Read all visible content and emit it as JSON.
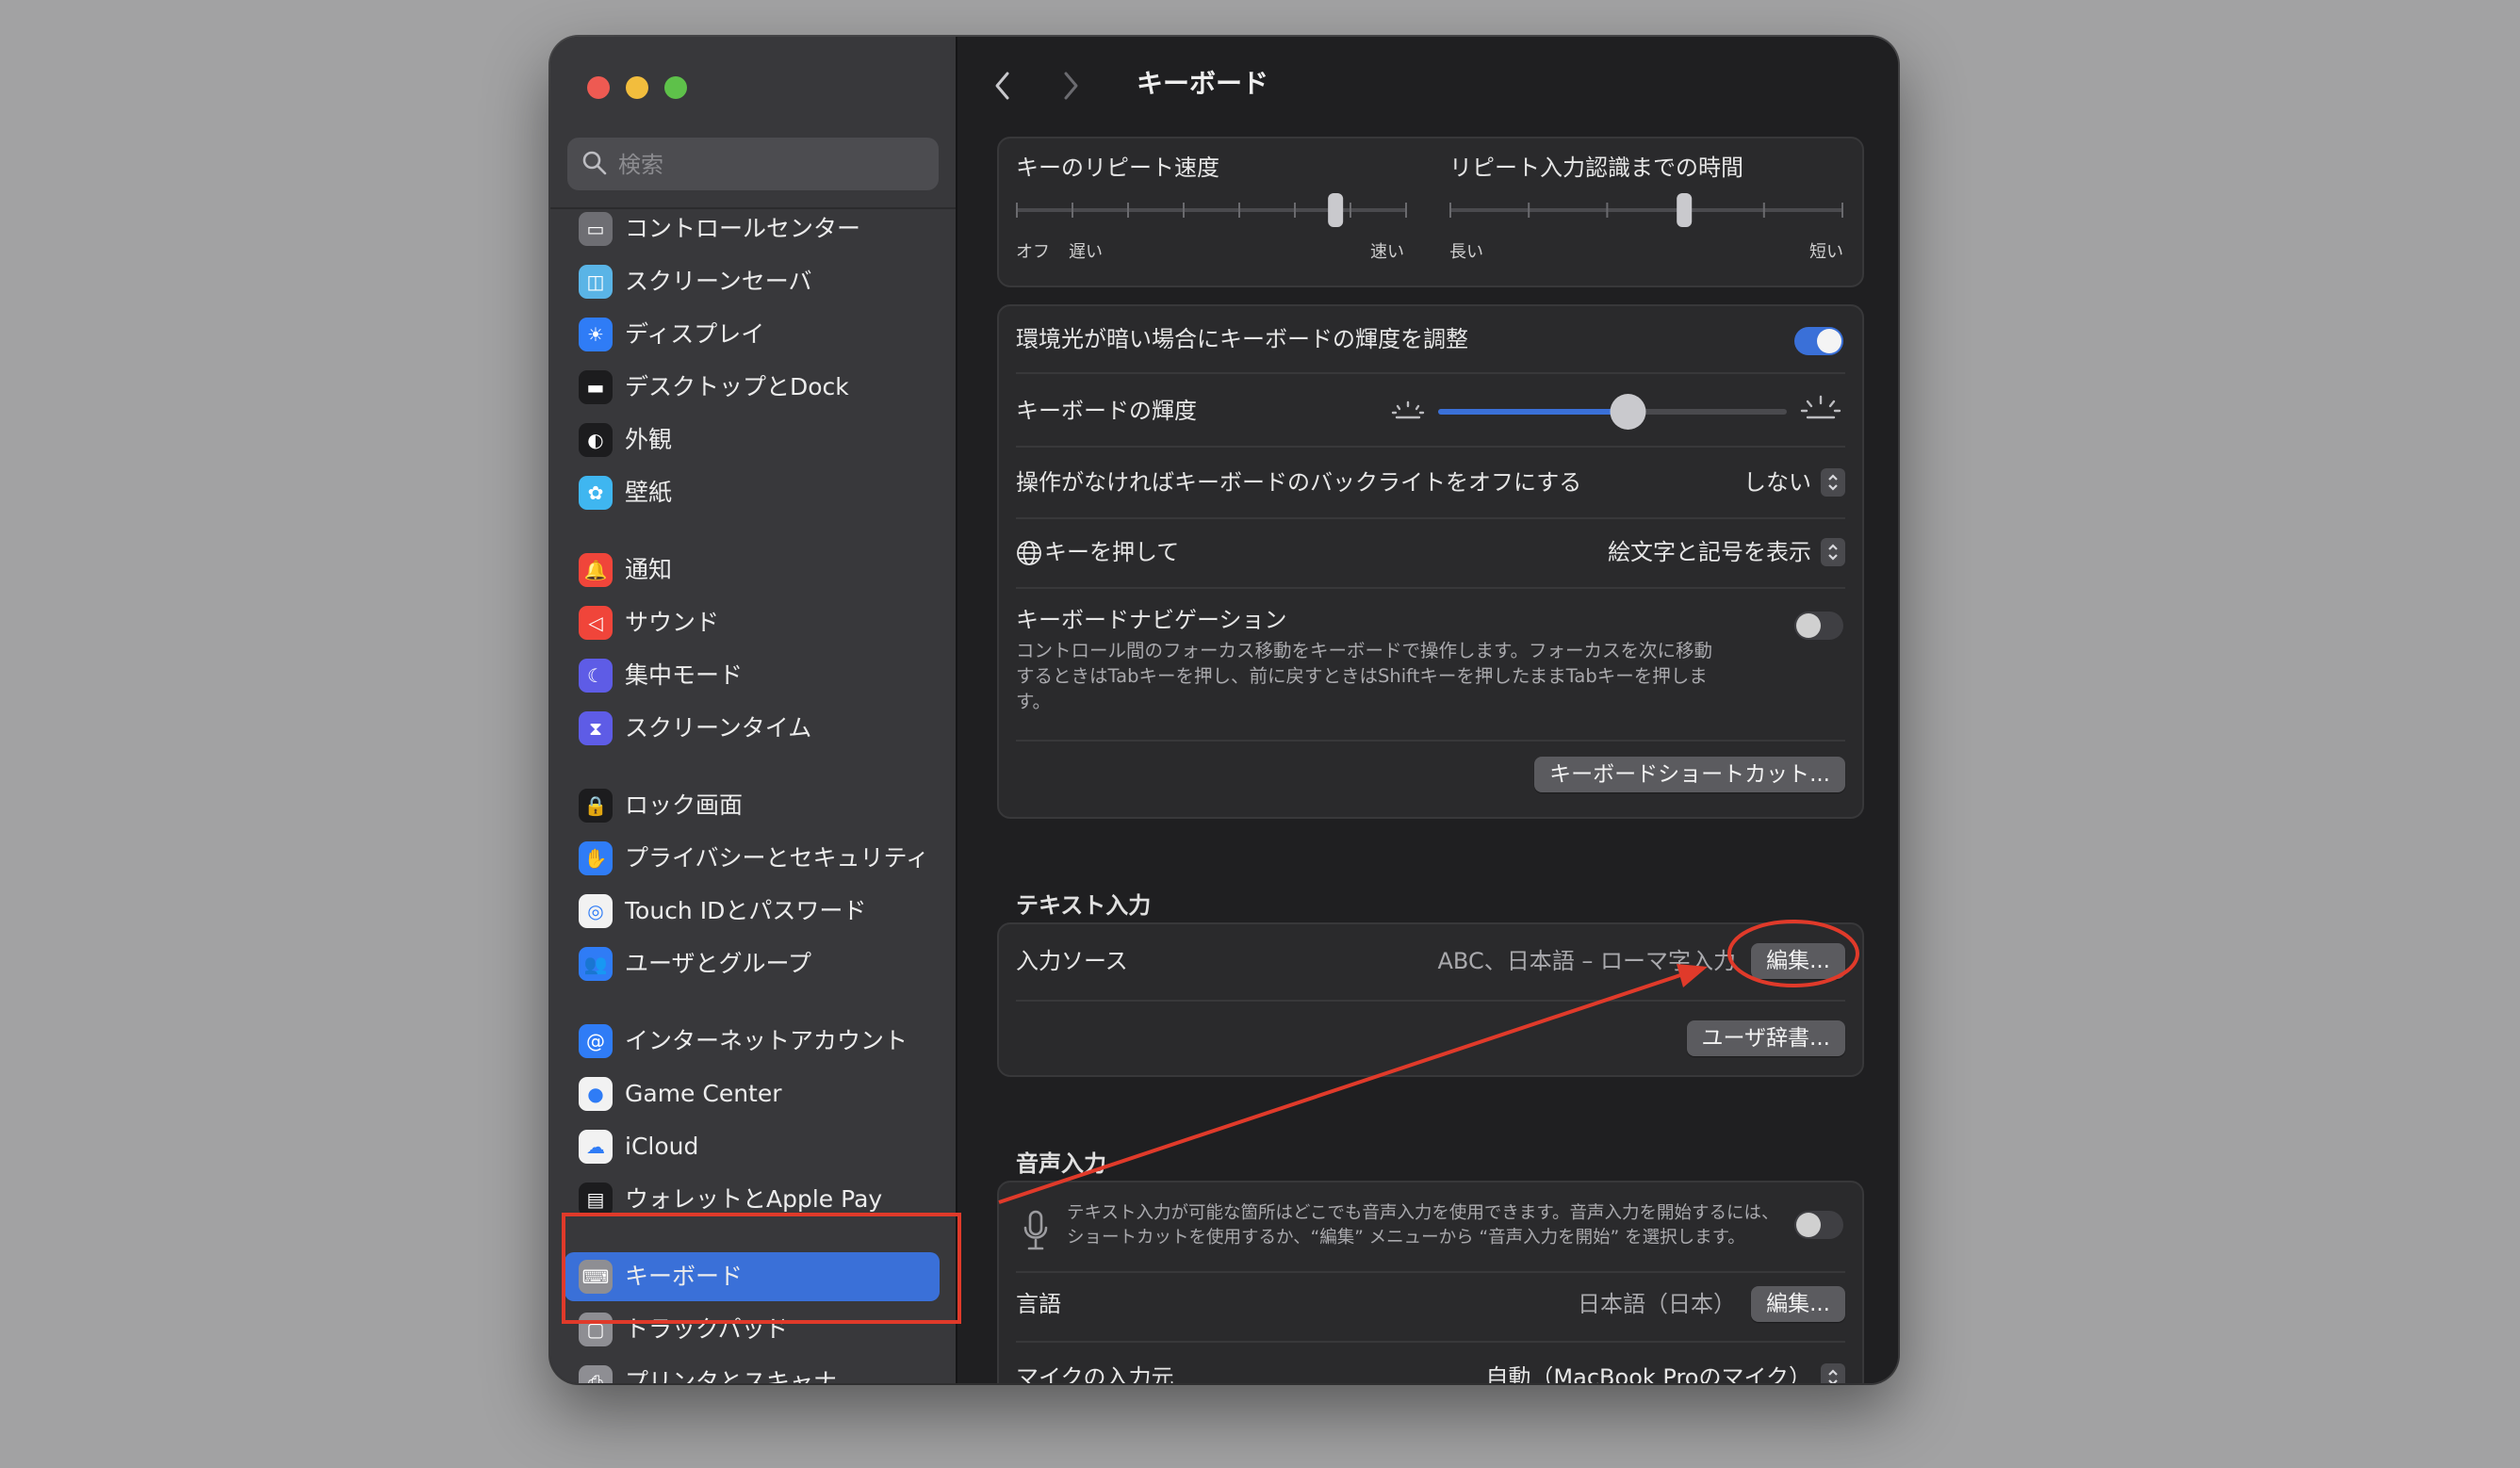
{
  "window": {
    "title": "キーボード"
  },
  "search": {
    "placeholder": "検索"
  },
  "sidebar": {
    "items": [
      {
        "label": "コントロールセンター",
        "icon": "control-center-icon",
        "color": "#6e6e73"
      },
      {
        "label": "スクリーンセーバ",
        "icon": "screen-saver-icon",
        "color": "#5ab4e6"
      },
      {
        "label": "ディスプレイ",
        "icon": "display-icon",
        "color": "#2f7cf6"
      },
      {
        "label": "デスクトップとDock",
        "icon": "dock-icon",
        "color": "#1c1c1e"
      },
      {
        "label": "外観",
        "icon": "appearance-icon",
        "color": "#1c1c1e"
      },
      {
        "label": "壁紙",
        "icon": "wallpaper-icon",
        "color": "#3fb6f0"
      },
      {
        "label": "通知",
        "icon": "notifications-icon",
        "color": "#f0453a"
      },
      {
        "label": "サウンド",
        "icon": "sound-icon",
        "color": "#f0453a"
      },
      {
        "label": "集中モード",
        "icon": "focus-icon",
        "color": "#5e5ce6"
      },
      {
        "label": "スクリーンタイム",
        "icon": "screen-time-icon",
        "color": "#5e5ce6"
      },
      {
        "label": "ロック画面",
        "icon": "lock-icon",
        "color": "#1c1c1e"
      },
      {
        "label": "プライバシーとセキュリティ",
        "icon": "hand-icon",
        "color": "#2f7cf6"
      },
      {
        "label": "Touch IDとパスワード",
        "icon": "fingerprint-icon",
        "color": "#f2f2f2"
      },
      {
        "label": "ユーザとグループ",
        "icon": "users-icon",
        "color": "#2f7cf6"
      },
      {
        "label": "インターネットアカウント",
        "icon": "at-icon",
        "color": "#2f7cf6"
      },
      {
        "label": "Game Center",
        "icon": "game-center-icon",
        "color": "#f2f2f2"
      },
      {
        "label": "iCloud",
        "icon": "icloud-icon",
        "color": "#f2f2f2"
      },
      {
        "label": "ウォレットとApple Pay",
        "icon": "wallet-icon",
        "color": "#1c1c1e"
      },
      {
        "label": "キーボード",
        "icon": "keyboard-icon",
        "color": "#8e8e93",
        "selected": true
      },
      {
        "label": "トラックパッド",
        "icon": "trackpad-icon",
        "color": "#8e8e93"
      },
      {
        "label": "プリンタとスキャナ",
        "icon": "printer-icon",
        "color": "#8e8e93"
      }
    ]
  },
  "repeat": {
    "rate_label": "キーのリピート速度",
    "rate_min": "オフ",
    "rate_slow": "遅い",
    "rate_max": "速い",
    "rate_level": 0.83,
    "delay_label": "リピート入力認識までの時間",
    "delay_min": "長い",
    "delay_max": "短い",
    "delay_level": 0.6
  },
  "brightness": {
    "auto_label": "環境光が暗い場合にキーボードの輝度を調整",
    "auto_on": true,
    "level_label": "キーボードの輝度",
    "level": 0.55,
    "backlight_label": "操作がなければキーボードのバックライトをオフにする",
    "backlight_value": "しない",
    "globe_label": "キーを押して",
    "globe_value": "絵文字と記号を表示",
    "nav_label": "キーボードナビゲーション",
    "nav_desc": "コントロール間のフォーカス移動をキーボードで操作します。フォーカスを次に移動するときはTabキーを押し、前に戻すときはShiftキーを押したままTabキーを押します。",
    "nav_on": false,
    "shortcuts_button": "キーボードショートカット..."
  },
  "text_input": {
    "heading": "テキスト入力",
    "sources_label": "入力ソース",
    "sources_value": "ABC、日本語 – ローマ字入力",
    "edit_button": "編集...",
    "dictionary_button": "ユーザ辞書..."
  },
  "dictation": {
    "heading": "音声入力",
    "desc": "テキスト入力が可能な箇所はどこでも音声入力を使用できます。音声入力を開始するには、ショートカットを使用するか、“編集” メニューから “音声入力を開始” を選択します。",
    "on": false,
    "language_label": "言語",
    "language_value": "日本語（日本）",
    "language_edit": "編集...",
    "mic_label": "マイクの入力元",
    "mic_value": "自動（MacBook Proのマイク）"
  },
  "annotations": {
    "color": "#e03a2a"
  }
}
